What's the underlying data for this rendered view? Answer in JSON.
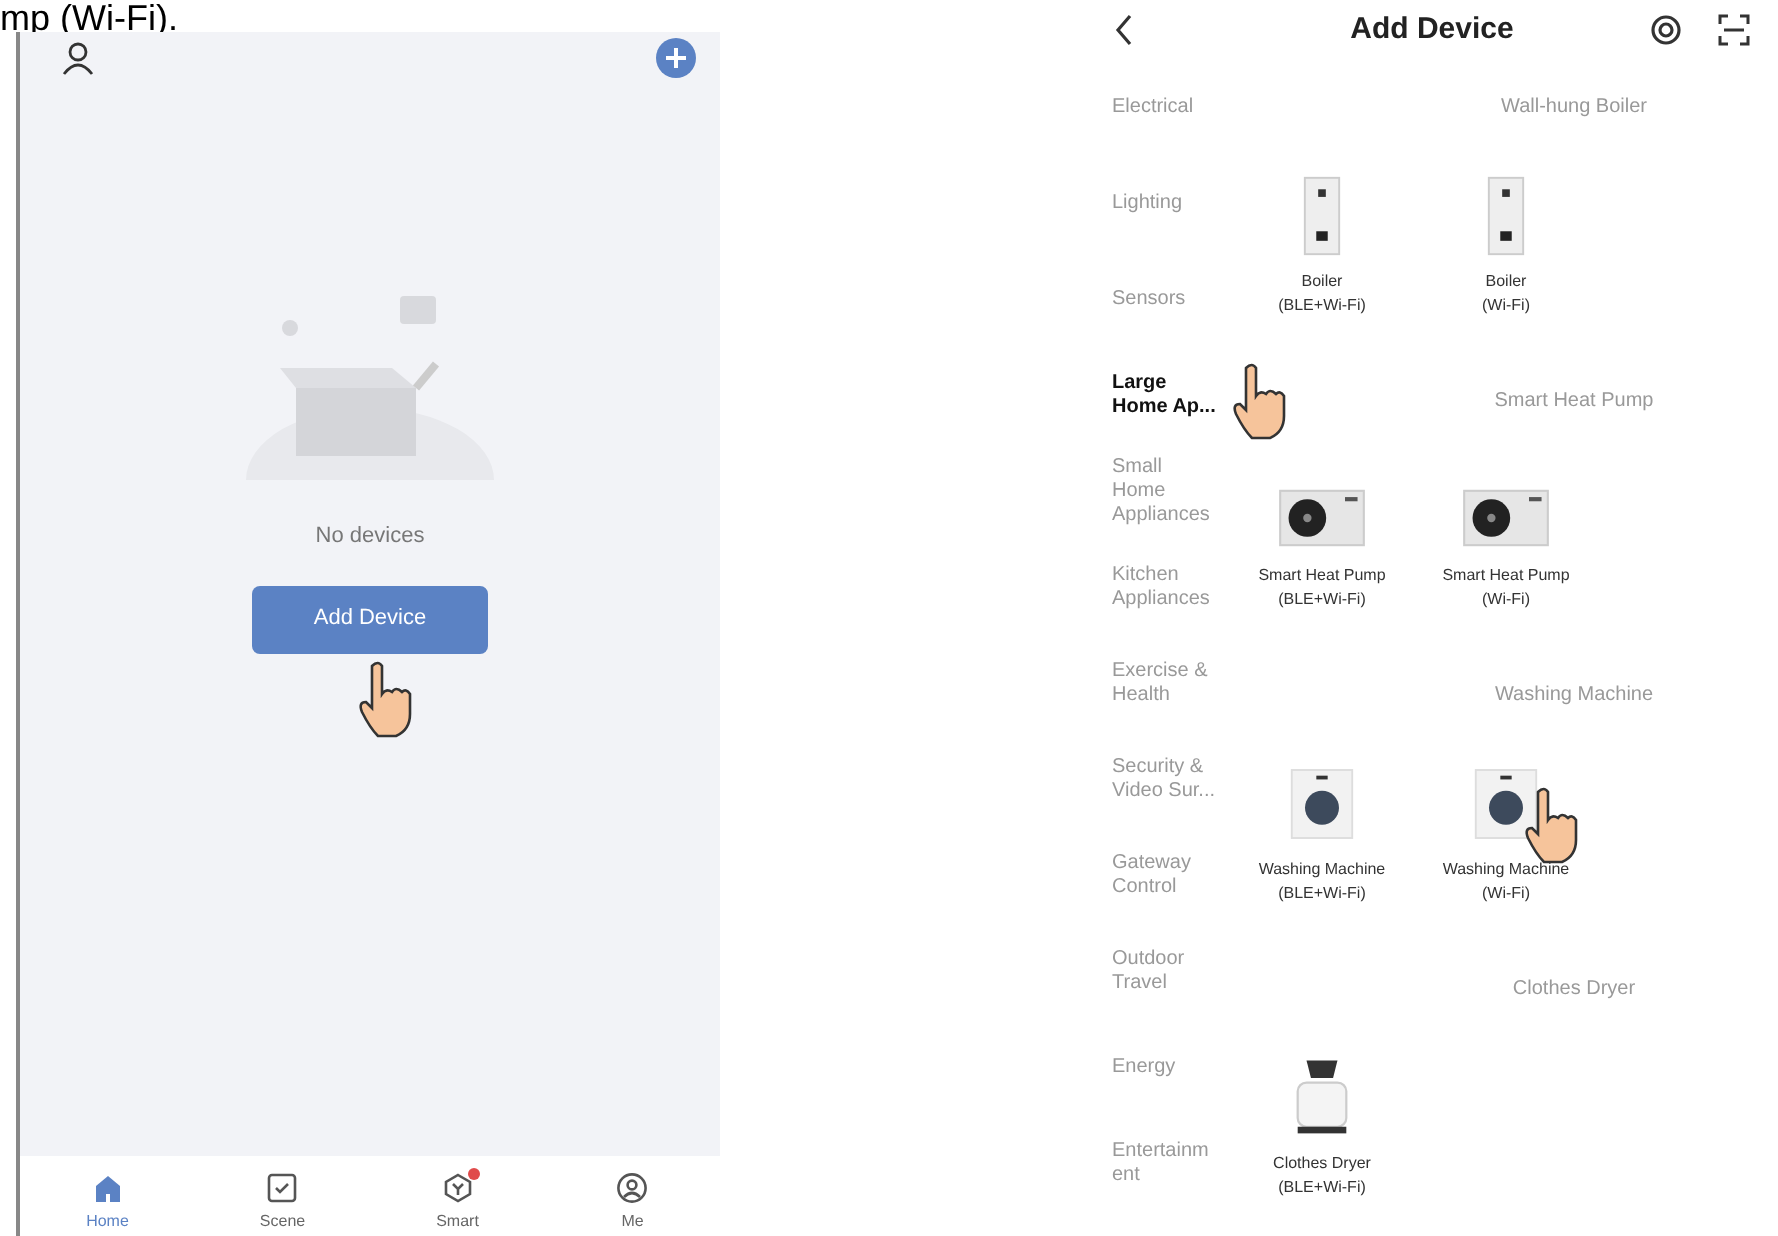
{
  "caption": "mp (Wi-Fi).",
  "home_screen": {
    "empty_message": "No devices",
    "add_button": "Add Device",
    "tabs": [
      {
        "label": "Home",
        "kind": "home",
        "selected": true,
        "badge": false
      },
      {
        "label": "Scene",
        "kind": "scene",
        "selected": false,
        "badge": false
      },
      {
        "label": "Smart",
        "kind": "smart",
        "selected": false,
        "badge": true
      },
      {
        "label": "Me",
        "kind": "me",
        "selected": false,
        "badge": false
      }
    ]
  },
  "add_device_screen": {
    "title": "Add Device",
    "categories": [
      {
        "label": "Electrical",
        "selected": false
      },
      {
        "label": "Lighting",
        "selected": false
      },
      {
        "label": "Sensors",
        "selected": false
      },
      {
        "label": "Large Home Ap...",
        "selected": true
      },
      {
        "label": "Small Home Appliances",
        "selected": false
      },
      {
        "label": "Kitchen Appliances",
        "selected": false
      },
      {
        "label": "Exercise & Health",
        "selected": false
      },
      {
        "label": "Security & Video Sur...",
        "selected": false
      },
      {
        "label": "Gateway Control",
        "selected": false
      },
      {
        "label": "Outdoor Travel",
        "selected": false
      },
      {
        "label": "Energy",
        "selected": false
      },
      {
        "label": "Entertainm ent",
        "selected": false
      }
    ],
    "sections": [
      {
        "title": "Wall-hung Boiler",
        "devices": [
          {
            "kind": "boiler",
            "name": "Boiler",
            "protocol": "(BLE+Wi-Fi)"
          },
          {
            "kind": "boiler",
            "name": "Boiler",
            "protocol": "(Wi-Fi)"
          }
        ]
      },
      {
        "title": "Smart Heat Pump",
        "devices": [
          {
            "kind": "heat-pump",
            "name": "Smart Heat Pump",
            "protocol": "(BLE+Wi-Fi)"
          },
          {
            "kind": "heat-pump",
            "name": "Smart Heat Pump",
            "protocol": "(Wi-Fi)"
          }
        ]
      },
      {
        "title": "Washing Machine",
        "devices": [
          {
            "kind": "washer",
            "name": "Washing Machine",
            "protocol": "(BLE+Wi-Fi)"
          },
          {
            "kind": "washer",
            "name": "Washing Machine",
            "protocol": "(Wi-Fi)"
          }
        ]
      },
      {
        "title": "Clothes Dryer",
        "devices": [
          {
            "kind": "dryer",
            "name": "Clothes Dryer",
            "protocol": "(BLE+Wi-Fi)"
          }
        ]
      }
    ]
  }
}
